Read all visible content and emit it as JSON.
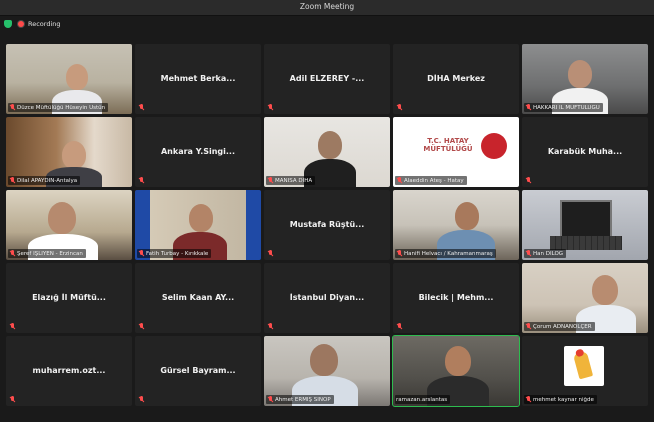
{
  "window": {
    "title": "Zoom Meeting"
  },
  "status": {
    "recording_label": "Recording"
  },
  "colors": {
    "active_speaker_border": "#2ebc4f",
    "muted_icon": "#ff4d4d",
    "recording_dot": "#ff4a4a",
    "tile_bg": "#232323"
  },
  "tiles": [
    {
      "type": "video",
      "label": "Düzce Müftülüğü Hüseyin Üstün"
    },
    {
      "type": "name",
      "name": "Mehmet Berka..."
    },
    {
      "type": "name",
      "name": "Adil ELZEREY -..."
    },
    {
      "type": "name",
      "name": "DİHA Merkez"
    },
    {
      "type": "video",
      "label": "HAKKARİ İL MÜFTÜLÜĞÜ"
    },
    {
      "type": "video",
      "label": "Dilal APAYDIN-Antalya"
    },
    {
      "type": "name",
      "name": "Ankara Y.Singi..."
    },
    {
      "type": "video",
      "label": "MANİSA DİHA"
    },
    {
      "type": "video",
      "label": "Alaeddin Ateş - Hatay",
      "logo_text": "T.C. HATAY MÜFTÜLÜĞÜ"
    },
    {
      "type": "name",
      "name": "Karabük Muha..."
    },
    {
      "type": "video",
      "label": "Şeref IŞLIYEN - Erzincan"
    },
    {
      "type": "video",
      "label": "Fatih Turbay - Kırıkkale"
    },
    {
      "type": "name",
      "name": "Mustafa Rüştü..."
    },
    {
      "type": "video",
      "label": "Hanifi Helvacı / Kahramanmaraş"
    },
    {
      "type": "video",
      "label": "Han DİLOĞ"
    },
    {
      "type": "name",
      "name": "Elazığ İl Müftü..."
    },
    {
      "type": "name",
      "name": "Selim Kaan AY..."
    },
    {
      "type": "name",
      "name": "İstanbul Diyan..."
    },
    {
      "type": "name",
      "name": "Bilecik | Mehm..."
    },
    {
      "type": "video",
      "label": "Çorum ADNANOLÇER"
    },
    {
      "type": "name",
      "name": "muharrem.ozt..."
    },
    {
      "type": "name",
      "name": "Gürsel Bayram..."
    },
    {
      "type": "video",
      "label": "Ahmet ERMİŞ SİNOP"
    },
    {
      "type": "video",
      "label": "ramazan.arslantas",
      "active": true
    },
    {
      "type": "video",
      "label": "mehmet kaynar niğde"
    }
  ]
}
